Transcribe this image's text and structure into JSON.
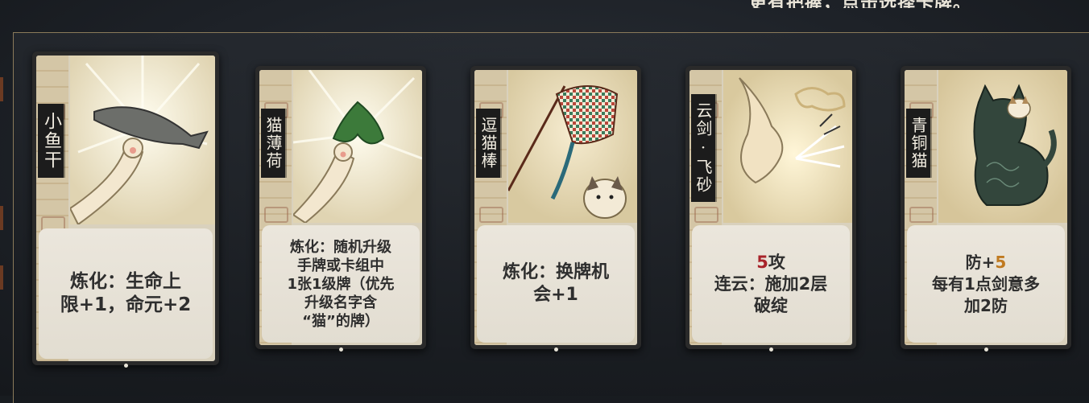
{
  "header": {
    "hint_text": "更有把握，点击选择卡牌。"
  },
  "cards": [
    {
      "name": "小鱼干",
      "effect_lines": [
        "炼化：生命上",
        "限+1，命元+2"
      ],
      "art_icon": "dried-fish-icon",
      "selected": true
    },
    {
      "name": "猫薄荷",
      "effect_lines": [
        "炼化：随机升级",
        "手牌或卡组中",
        "1张1级牌（优先",
        "升级名字含",
        "“猫”的牌）"
      ],
      "art_icon": "catnip-icon"
    },
    {
      "name": "逗猫棒",
      "effect_lines": [
        "炼化：换牌机",
        "会+1"
      ],
      "art_icon": "cat-teaser-icon"
    },
    {
      "name": "云剑·飞砂",
      "attack_value": "5",
      "attack_label": "攻",
      "effect_lines": [
        "连云：施加2层",
        "破绽"
      ],
      "art_icon": "sword-cloud-icon"
    },
    {
      "name": "青铜猫",
      "defense_label": "防+",
      "defense_value": "5",
      "effect_lines": [
        "每有1点剑意多",
        "加2防"
      ],
      "art_icon": "bronze-cat-icon"
    }
  ],
  "colors": {
    "attack_number": "#a8232a",
    "defense_number": "#c07a20",
    "panel_border": "#8a7a5a"
  }
}
